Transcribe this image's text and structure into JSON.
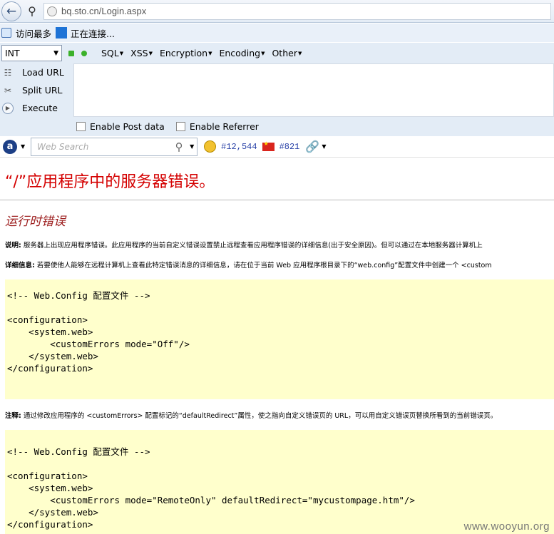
{
  "address_bar": {
    "url": "bq.sto.cn/Login.aspx"
  },
  "bookmarks": [
    "访问最多",
    "正在连接..."
  ],
  "hackbar": {
    "type_select": "INT",
    "menus": [
      "SQL",
      "XSS",
      "Encryption",
      "Encoding",
      "Other"
    ],
    "side_actions": [
      "Load URL",
      "Split URL",
      "Execute"
    ],
    "options": [
      "Enable Post data",
      "Enable Referrer"
    ]
  },
  "toolbar": {
    "search_placeholder": "Web Search",
    "rank1": "#12,544",
    "rank2": "#821"
  },
  "page": {
    "title": "“/”应用程序中的服务器错误。",
    "subtitle": "运行时错误",
    "desc_label": "说明:",
    "desc_text": " 服务器上出现应用程序错误。此应用程序的当前自定义错误设置禁止远程查看应用程序错误的详细信息(出于安全原因)。但可以通过在本地服务器计算机上",
    "detail_label": "详细信息:",
    "detail_text": " 若要使他人能够在远程计算机上查看此特定错误消息的详细信息，请在位于当前 Web 应用程序根目录下的“web.config”配置文件中创建一个 <custom",
    "code1": "<!-- Web.Config 配置文件 -->\n\n<configuration>\n    <system.web>\n        <customErrors mode=\"Off\"/>\n    </system.web>\n</configuration>",
    "note_label": "注释:",
    "note_text": " 通过修改应用程序的 <customErrors> 配置标记的“defaultRedirect”属性，使之指向自定义错误页的 URL，可以用自定义错误页替换所看到的当前错误页。",
    "code2": "<!-- Web.Config 配置文件 -->\n\n<configuration>\n    <system.web>\n        <customErrors mode=\"RemoteOnly\" defaultRedirect=\"mycustompage.htm\"/>\n    </system.web>\n</configuration>"
  },
  "watermark": "www.wooyun.org",
  "colors": {
    "error_title": "#d40000",
    "subtitle": "#9c1c1c",
    "code_bg": "#ffffcc"
  }
}
